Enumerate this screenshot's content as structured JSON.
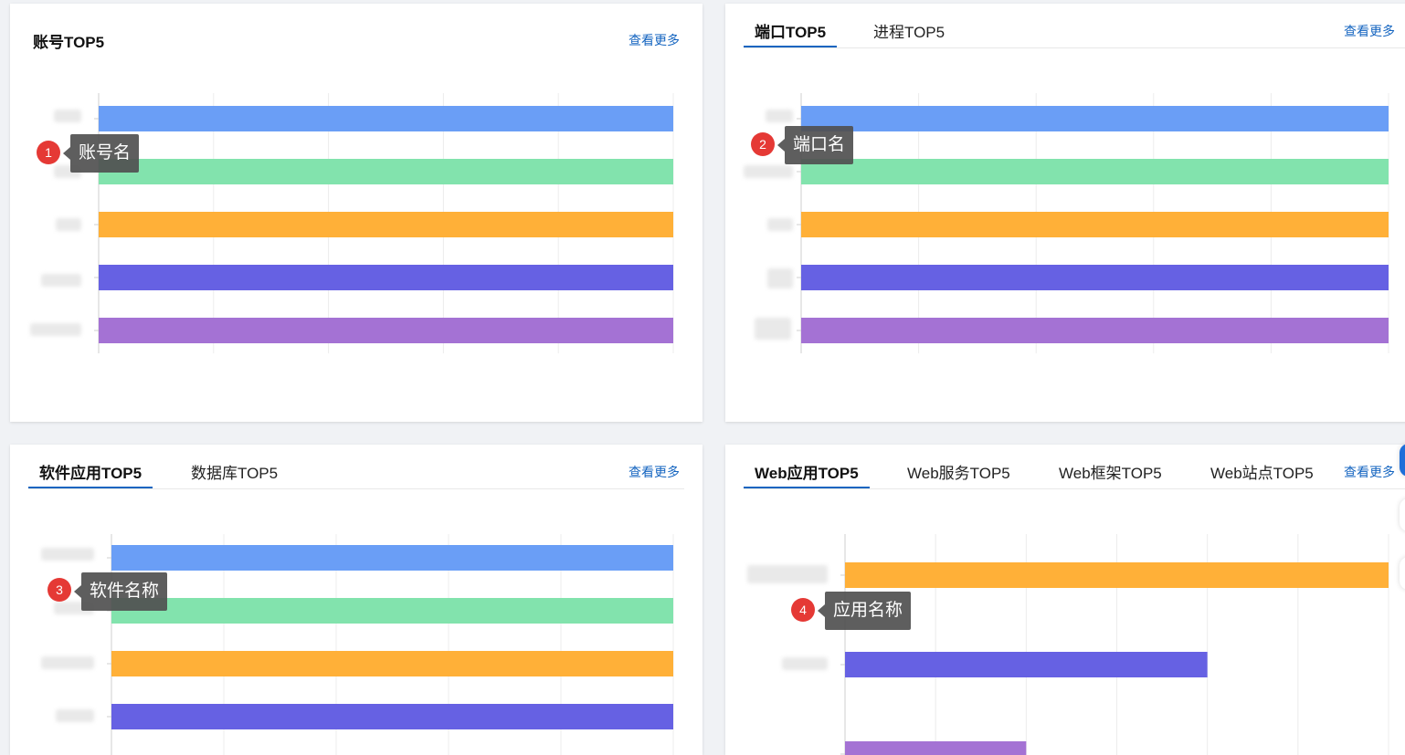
{
  "colors": {
    "blue": "#6a9ef6",
    "green": "#82e3ad",
    "orange": "#ffb038",
    "indigo": "#6661e3",
    "purple": "#a472d4",
    "accent": "#1565c0",
    "badge": "#e53935"
  },
  "account_card": {
    "title": "账号TOP5",
    "more": "查看更多",
    "tooltip": "账号名",
    "badge": "1"
  },
  "port_card": {
    "tabs": [
      "端口TOP5",
      "进程TOP5"
    ],
    "active_tab": "端口TOP5",
    "more": "查看更多",
    "tooltip": "端口名",
    "badge": "2"
  },
  "software_card": {
    "tabs": [
      "软件应用TOP5",
      "数据库TOP5"
    ],
    "active_tab": "软件应用TOP5",
    "more": "查看更多",
    "tooltip": "软件名称",
    "badge": "3"
  },
  "web_card": {
    "tabs": [
      "Web应用TOP5",
      "Web服务TOP5",
      "Web框架TOP5",
      "Web站点TOP5"
    ],
    "active_tab": "Web应用TOP5",
    "more": "查看更多",
    "tooltip": "应用名称",
    "badge": "4"
  },
  "chart_data": [
    {
      "type": "bar",
      "orientation": "horizontal",
      "categories": [
        "",
        "",
        "",
        "",
        ""
      ],
      "values": [
        1,
        1,
        1,
        1,
        1
      ],
      "xlim": [
        0,
        1
      ],
      "grid": true,
      "colors": [
        "#6a9ef6",
        "#82e3ad",
        "#ffb038",
        "#6661e3",
        "#a472d4"
      ]
    },
    {
      "type": "bar",
      "orientation": "horizontal",
      "categories": [
        "",
        "",
        "",
        "",
        ""
      ],
      "values": [
        1,
        1,
        1,
        1,
        1
      ],
      "xlim": [
        0,
        1
      ],
      "grid": true,
      "colors": [
        "#6a9ef6",
        "#82e3ad",
        "#ffb038",
        "#6661e3",
        "#a472d4"
      ]
    },
    {
      "type": "bar",
      "orientation": "horizontal",
      "categories": [
        "",
        "",
        "",
        ""
      ],
      "values": [
        1,
        1,
        1,
        1
      ],
      "xlim": [
        0,
        1
      ],
      "grid": true,
      "colors": [
        "#6a9ef6",
        "#82e3ad",
        "#ffb038",
        "#6661e3"
      ]
    },
    {
      "type": "bar",
      "orientation": "horizontal",
      "categories": [
        "",
        "",
        ""
      ],
      "values": [
        6,
        4,
        2
      ],
      "xlim": [
        0,
        6
      ],
      "grid": true,
      "colors": [
        "#ffb038",
        "#6661e3",
        "#a472d4"
      ]
    }
  ]
}
